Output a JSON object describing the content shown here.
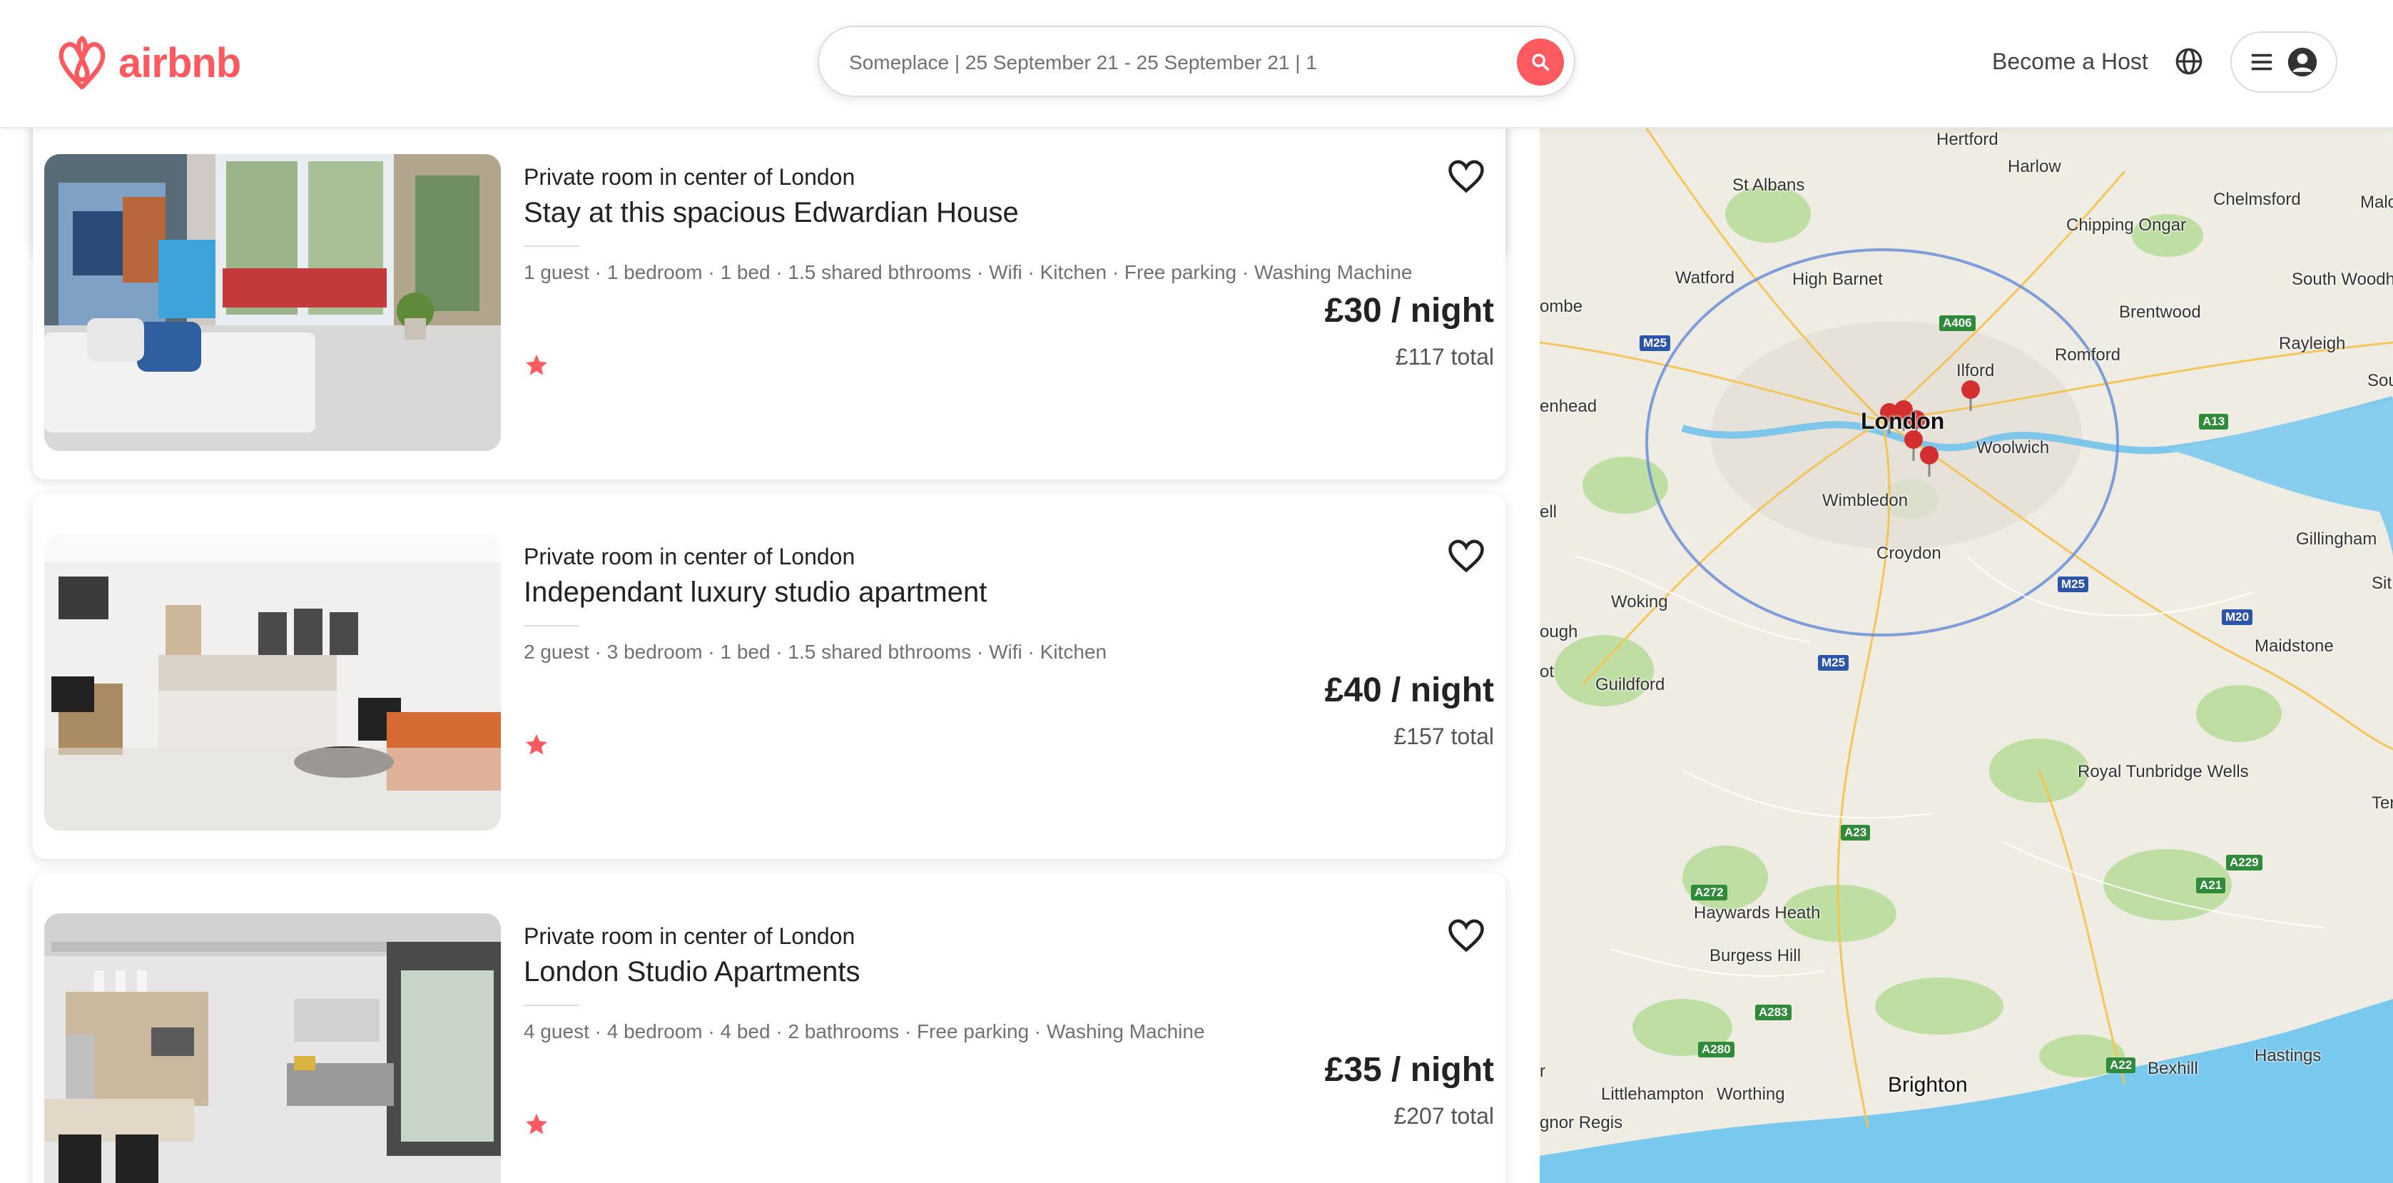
{
  "app": {
    "logo_text": "airbnb",
    "brand_color": "#FF5A5F"
  },
  "header": {
    "search_text": "Someplace | 25 September 21 - 25 September 21 | 1",
    "become_host": "Become a Host",
    "icons": [
      "search-icon",
      "globe-icon",
      "menu-icon",
      "user-icon"
    ]
  },
  "listings": [
    {
      "room_type": "Private room in center of London",
      "title": "Stay at this spacious Edwardian House",
      "amenities": "1 guest · 1 bedroom · 1 bed · 1.5 shared bthrooms · Wifi · Kitchen · Free parking · Washing Machine",
      "price": "£30 / night",
      "total": "£117 total"
    },
    {
      "room_type": "Private room in center of London",
      "title": "Independant luxury studio apartment",
      "amenities": "2 guest · 3 bedroom · 1 bed · 1.5 shared bthrooms · Wifi · Kitchen",
      "price": "£40 / night",
      "total": "£157 total"
    },
    {
      "room_type": "Private room in center of London",
      "title": "London Studio Apartments",
      "amenities": "4 guest · 4 bedroom · 4 bed · 2 bathrooms · Free parking · Washing Machine",
      "price": "£35 / night",
      "total": "£207 total"
    }
  ],
  "map": {
    "places": [
      "Hertford",
      "Harlow",
      "Chelmsford",
      "Malo",
      "St Albans",
      "Chipping Ongar",
      "Watford",
      "High Barnet",
      "Brentwood",
      "South Woodham Ferrers",
      "ombe",
      "Ilford",
      "Romford",
      "Rayleigh",
      "Sou",
      "enhead",
      "London",
      "Woolwich",
      "ell",
      "Wimbledon",
      "Gillingham",
      "Croydon",
      "Sit",
      "Woking",
      "ough",
      "Maidstone",
      "ot",
      "Guildford",
      "Royal Tunbridge Wells",
      "Tent",
      "Haywards Heath",
      "Burgess Hill",
      "Hastings",
      "Bexhill",
      "Littlehampton",
      "Worthing",
      "Brighton",
      "gnor Regis",
      "r"
    ],
    "roads": [
      "A406",
      "M25",
      "A13",
      "M25",
      "M20",
      "M25",
      "A23",
      "A272",
      "A229",
      "A283",
      "A280",
      "A22",
      "A21"
    ],
    "pin_count": 6
  }
}
